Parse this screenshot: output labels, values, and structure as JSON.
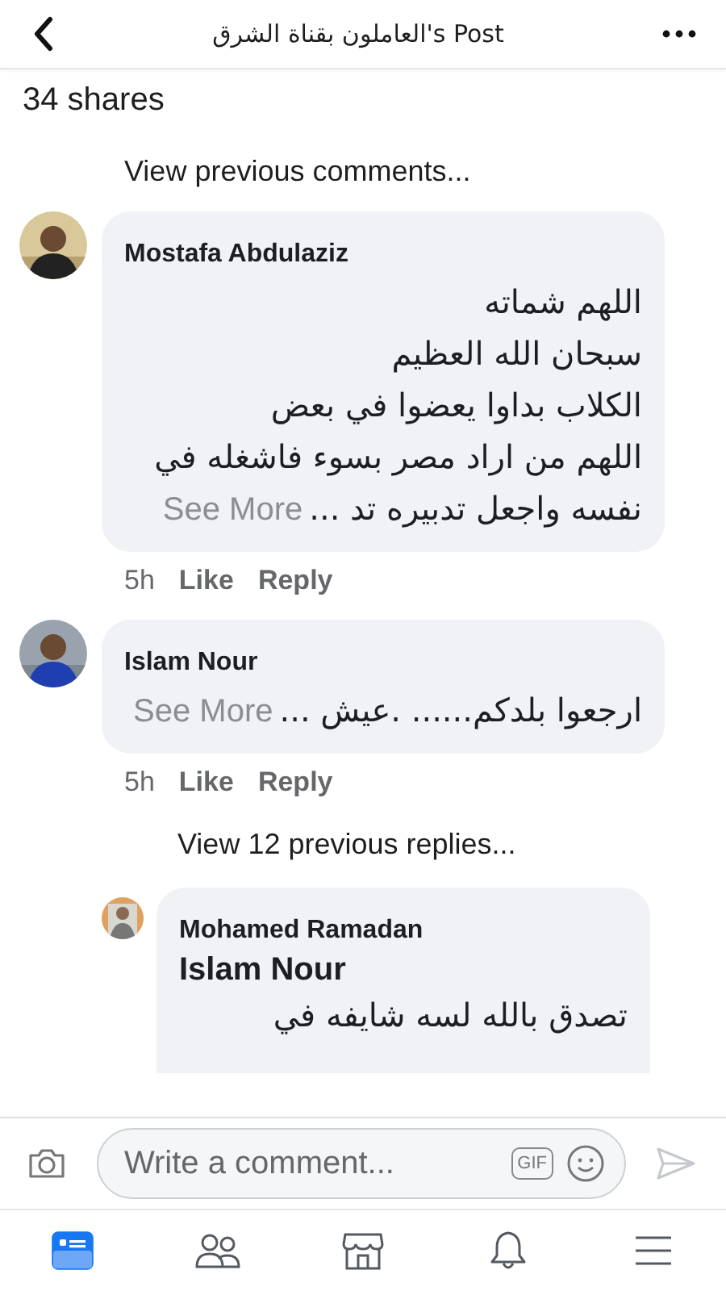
{
  "header": {
    "title": "العاملون بقناة الشرق's Post"
  },
  "shares": "34 shares",
  "view_previous_comments": "View previous comments...",
  "comments": [
    {
      "author": "Mostafa Abdulaziz",
      "lines": [
        "اللهم شماته",
        "سبحان الله العظيم",
        "الكلاب بداوا يعضوا في بعض",
        "اللهم من اراد مصر بسوء فاشغله في",
        "نفسه واجعل تدبيره تد ..."
      ],
      "see_more": "See More",
      "time": "5h",
      "like": "Like",
      "reply": "Reply"
    },
    {
      "author": "Islam Nour",
      "lines": [
        "ارجعوا بلدكم...... .عيش ..."
      ],
      "see_more": "See More",
      "time": "5h",
      "like": "Like",
      "reply": "Reply"
    }
  ],
  "view_previous_replies": "View 12 previous replies...",
  "reply": {
    "author": "Mohamed Ramadan",
    "mention": "Islam Nour",
    "lines": [
      "تصدق بالله لسه شايفه في"
    ]
  },
  "composer": {
    "placeholder": "Write a comment...",
    "gif": "GIF"
  },
  "nav": [
    {
      "kind": "feed",
      "selected": true
    },
    {
      "kind": "friends",
      "selected": false
    },
    {
      "kind": "marketplace",
      "selected": false
    },
    {
      "kind": "notifications",
      "selected": false
    },
    {
      "kind": "menu",
      "selected": false
    }
  ]
}
